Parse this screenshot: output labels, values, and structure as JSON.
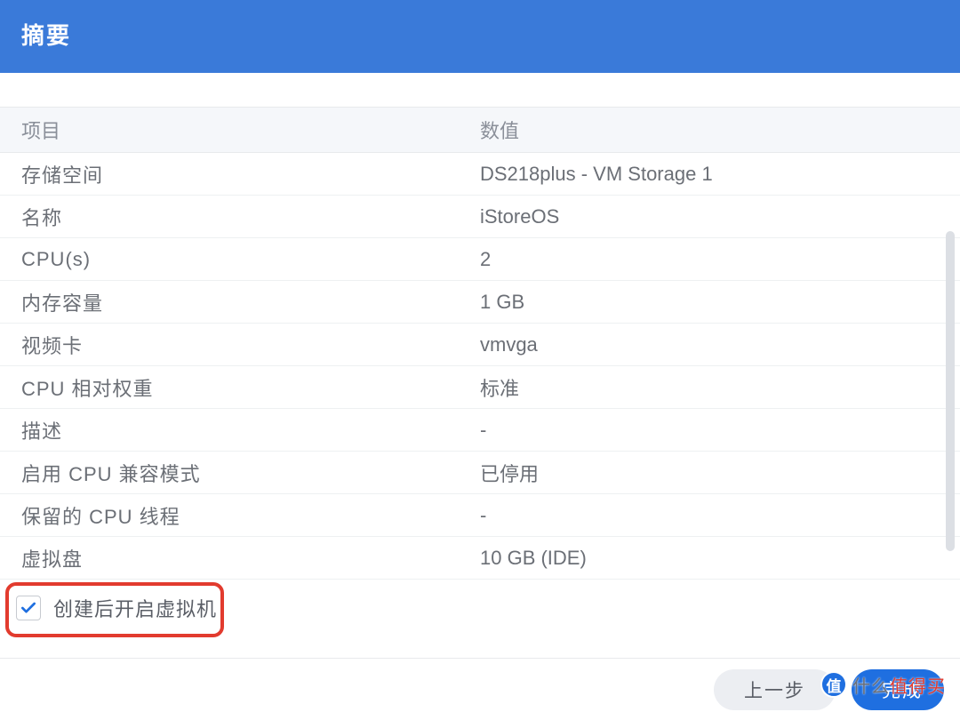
{
  "header": {
    "title": "摘要"
  },
  "table": {
    "headers": {
      "key": "项目",
      "value": "数值"
    },
    "rows": [
      {
        "k": "存储空间",
        "v": "DS218plus - VM Storage 1"
      },
      {
        "k": "名称",
        "v": "iStoreOS"
      },
      {
        "k": "CPU(s)",
        "v": "2"
      },
      {
        "k": "内存容量",
        "v": "1 GB"
      },
      {
        "k": "视频卡",
        "v": "vmvga"
      },
      {
        "k": "CPU 相对权重",
        "v": "标准"
      },
      {
        "k": "描述",
        "v": "-"
      },
      {
        "k": "启用 CPU 兼容模式",
        "v": "已停用"
      },
      {
        "k": "保留的 CPU 线程",
        "v": "-"
      },
      {
        "k": "虚拟盘",
        "v": "10 GB (IDE)"
      }
    ]
  },
  "checkbox": {
    "label": "创建后开启虚拟机",
    "checked": true
  },
  "footer": {
    "back": "上一步",
    "done": "完成"
  },
  "watermark": {
    "badge": "值",
    "text_a": "什么",
    "text_b": "值得买"
  }
}
